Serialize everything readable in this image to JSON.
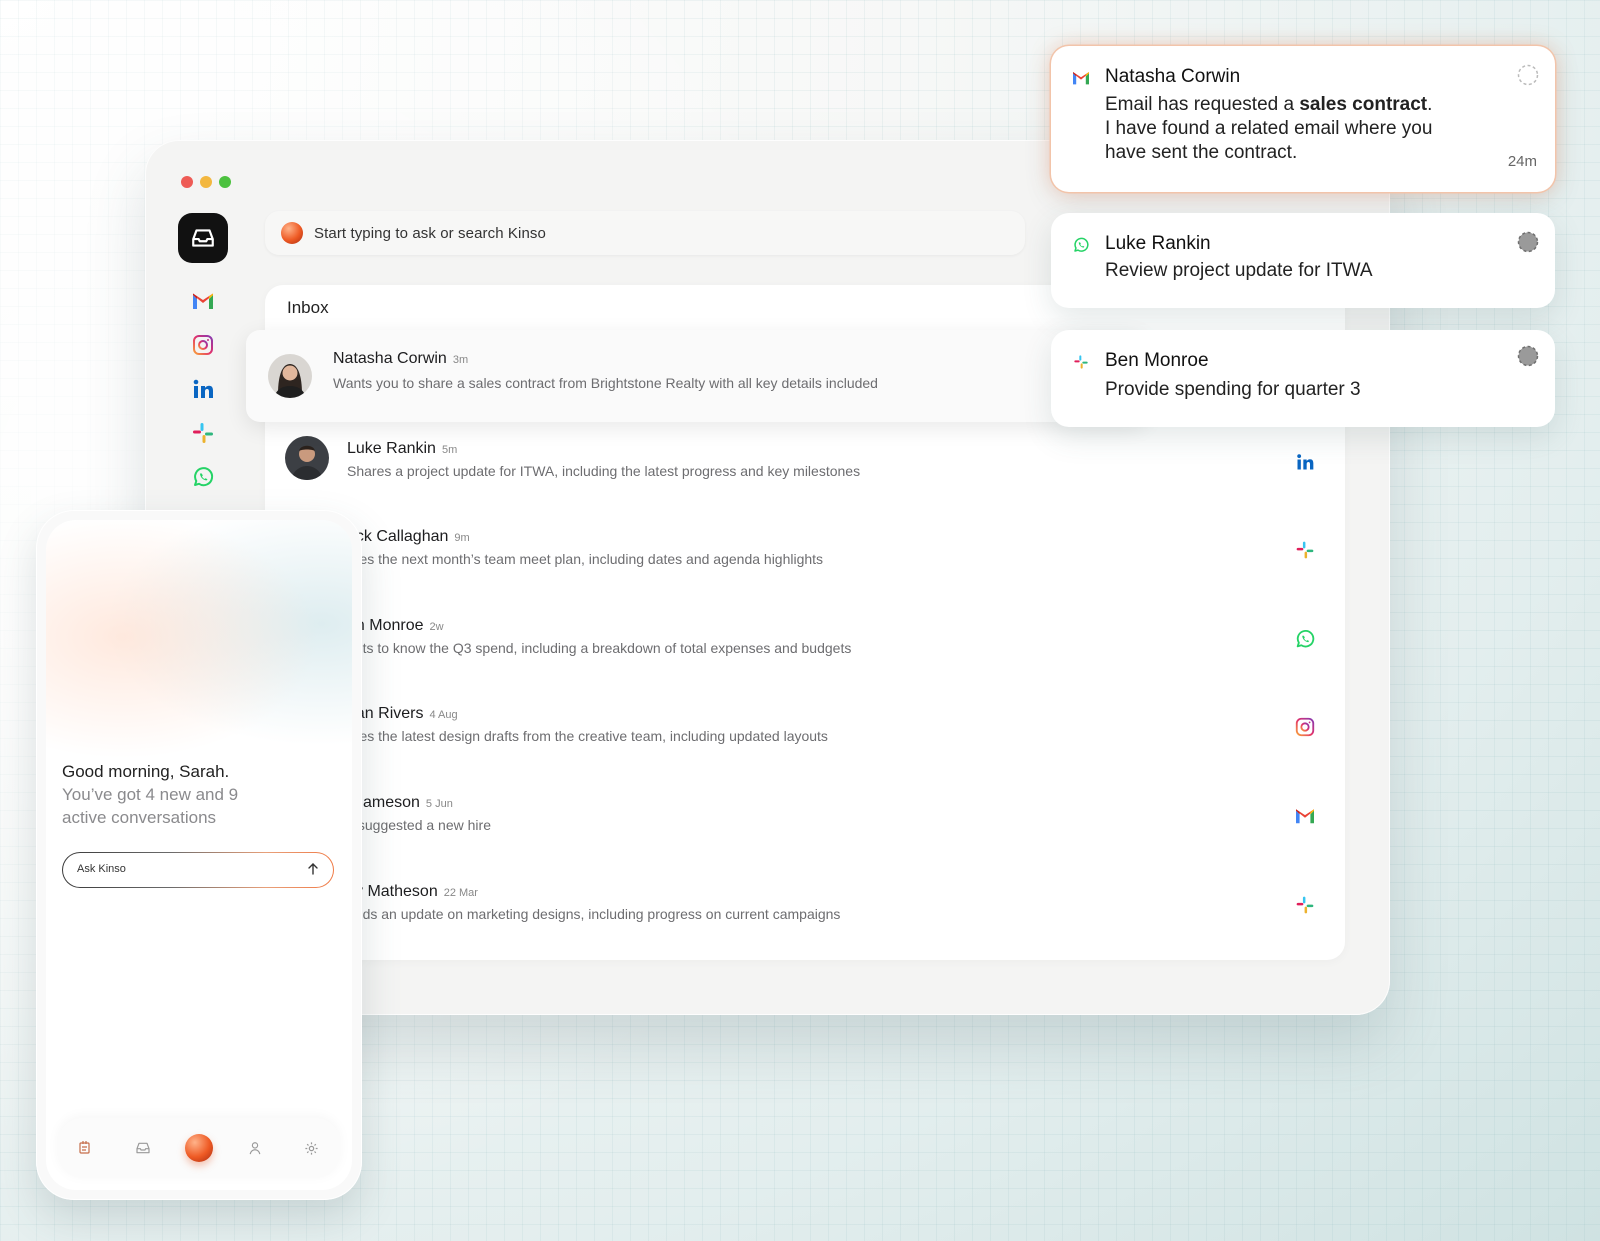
{
  "search": {
    "placeholder": "Start typing to ask or search Kinso"
  },
  "inbox": {
    "title": "Inbox",
    "rows": [
      {
        "name": "Natasha Corwin",
        "time": "3m",
        "text": "Wants you to share a sales contract from Brightstone Realty with all key details included",
        "icon": "gmail-icon"
      },
      {
        "name": "Luke Rankin",
        "time": "5m",
        "text": "Shares a project update for ITWA, including the latest progress and key milestones",
        "icon": "linkedin-icon"
      },
      {
        "name": "ack Callaghan",
        "time": "9m",
        "text": "ares the next month’s team meet plan, including dates and agenda highlights",
        "icon": "slack-icon"
      },
      {
        "name": "en Monroe",
        "time": "2w",
        "text": "ants to know the Q3 spend, including a breakdown of total expenses and budgets",
        "icon": "whatsapp-icon"
      },
      {
        "name": "han Rivers",
        "time": "4 Aug",
        "text": "ares the latest design drafts from the creative team, including updated layouts",
        "icon": "instagram-icon"
      },
      {
        "name": "i Jameson",
        "time": "5 Jun",
        "text": "s suggested a new hire",
        "icon": "gmail-icon"
      },
      {
        "name": "cy Matheson",
        "time": "22 Mar",
        "text": "eeds an update on marketing designs, including progress on current campaigns",
        "icon": "slack-icon"
      }
    ]
  },
  "notifications": [
    {
      "sender": "Natasha Corwin",
      "body_pre": "Email has requested a ",
      "body_bold": "sales contract",
      "body_post": ".",
      "body_line2": "I have found a related email where you",
      "body_line3": "have sent the contract.",
      "time": "24m",
      "icon": "gmail-icon"
    },
    {
      "sender": "Luke Rankin",
      "body": "Review project update for ITWA",
      "icon": "whatsapp-icon"
    },
    {
      "sender": "Ben Monroe",
      "body": "Provide spending for quarter 3",
      "icon": "slack-icon"
    }
  ],
  "phone": {
    "greeting": "Good morning, Sarah.",
    "summary": "You’ve got 4 new and 9 active conversations",
    "ask_placeholder": "Ask Kinso",
    "tabs": [
      "tasks-icon",
      "inbox-icon",
      "kinso-orb",
      "profile-icon",
      "settings-icon"
    ]
  },
  "colors": {
    "accent_orange": "#ee5a24",
    "gmail_red": "#ea4335",
    "linkedin_blue": "#0a66c2",
    "whatsapp_green": "#25d366",
    "instagram_pink": "#d6249f"
  }
}
